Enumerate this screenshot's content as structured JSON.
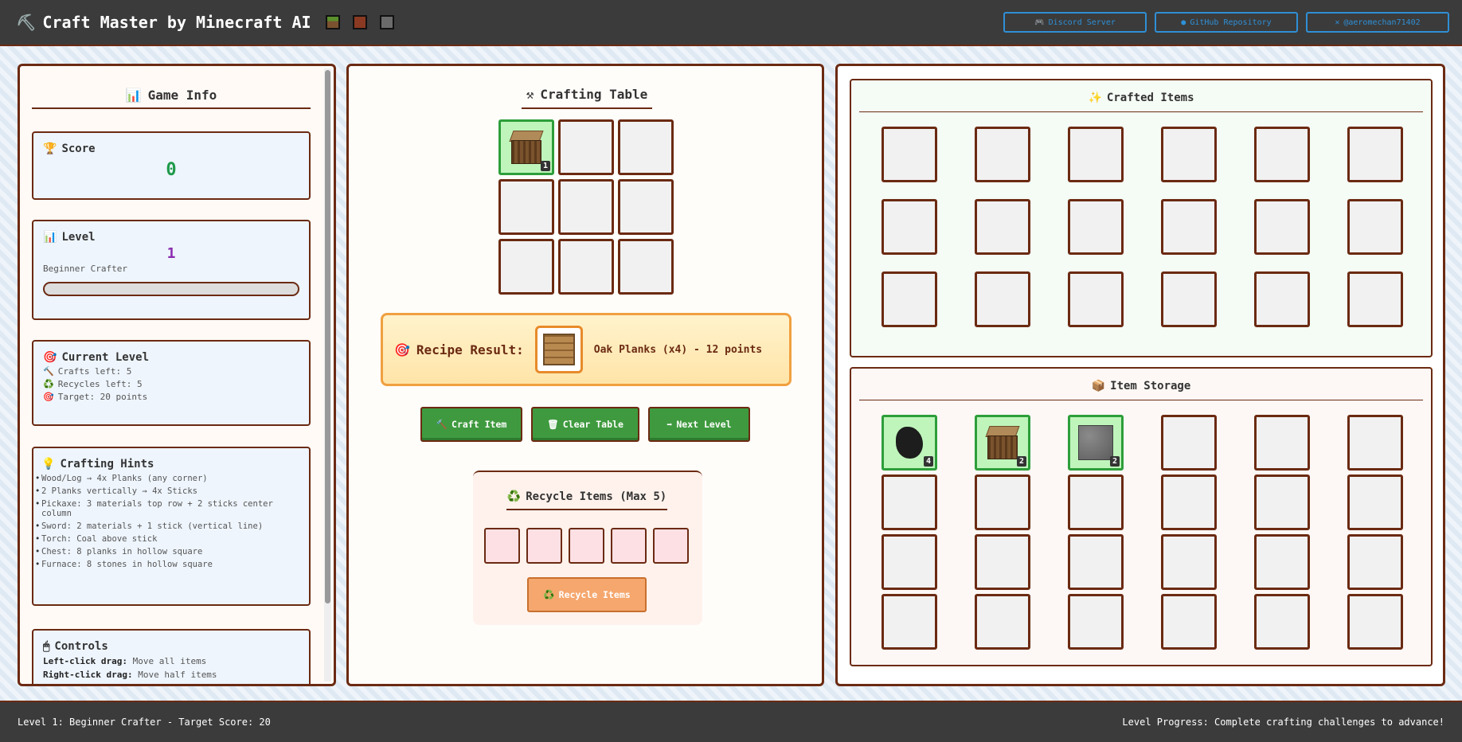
{
  "header": {
    "title": "Craft Master by Minecraft AI",
    "links": [
      {
        "label": "Discord Server",
        "icon": "discord-icon"
      },
      {
        "label": "GitHub Repository",
        "icon": "github-icon"
      },
      {
        "label": "@aeromechan71402",
        "icon": "x-icon"
      }
    ]
  },
  "game_info": {
    "title": "Game Info",
    "score": {
      "label": "Score",
      "value": "0"
    },
    "level": {
      "label": "Level",
      "value": "1",
      "name": "Beginner Crafter",
      "progress": 0
    },
    "current_level": {
      "label": "Current Level",
      "crafts": "Crafts left: 5",
      "recycles": "Recycles left: 5",
      "target": "Target: 20 points"
    },
    "hints": {
      "label": "Crafting Hints",
      "items": [
        "Wood/Log → 4x Planks (any corner)",
        "2 Planks vertically → 4x Sticks",
        "Pickaxe: 3 materials top row + 2 sticks center column",
        "Sword: 2 materials + 1 stick (vertical line)",
        "Torch: Coal above stick",
        "Chest: 8 planks in hollow square",
        "Furnace: 8 stones in hollow square"
      ]
    },
    "controls": {
      "label": "Controls",
      "left_key": "Left-click drag:",
      "left_desc": "Move all items",
      "right_key": "Right-click drag:",
      "right_desc": "Move half items"
    }
  },
  "crafting": {
    "title": "Crafting Table",
    "grid": [
      {
        "item": "oak-log",
        "qty": "1"
      },
      null,
      null,
      null,
      null,
      null,
      null,
      null,
      null
    ],
    "result_label": "Recipe Result:",
    "result_text": "Oak Planks (x4) - 12 points",
    "buttons": {
      "craft": "Craft Item",
      "clear": "Clear Table",
      "next": "Next Level"
    },
    "recycle": {
      "title": "Recycle Items (Max 5)",
      "button": "Recycle Items"
    }
  },
  "crafted": {
    "title": "Crafted Items"
  },
  "storage": {
    "title": "Item Storage",
    "items": [
      {
        "item": "coal",
        "qty": "4"
      },
      {
        "item": "oak-log",
        "qty": "2"
      },
      {
        "item": "stone",
        "qty": "2"
      }
    ]
  },
  "footer": {
    "left": "Level 1: Beginner Crafter - Target Score: 20",
    "right": "Level Progress: Complete crafting challenges to advance!"
  },
  "colors": {
    "accent_border": "#6b2a12",
    "score": "#1f9a4a",
    "level": "#8b2bb0",
    "button": "#3f9a3f",
    "link": "#2f8fd6"
  }
}
